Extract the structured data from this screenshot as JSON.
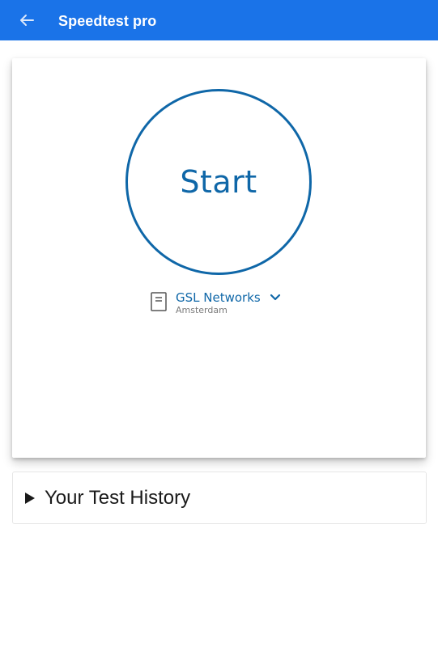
{
  "appbar": {
    "title": "Speedtest pro",
    "background": "#1a73e8",
    "back_icon": "arrow-left-icon"
  },
  "main": {
    "start_label": "Start",
    "accent": "#0f67a8",
    "server": {
      "name": "GSL Networks",
      "location": "Amsterdam",
      "icon": "server-document-icon",
      "dropdown_icon": "chevron-down-icon"
    }
  },
  "history": {
    "label": "Your Test History",
    "icon": "triangle-right-icon"
  }
}
